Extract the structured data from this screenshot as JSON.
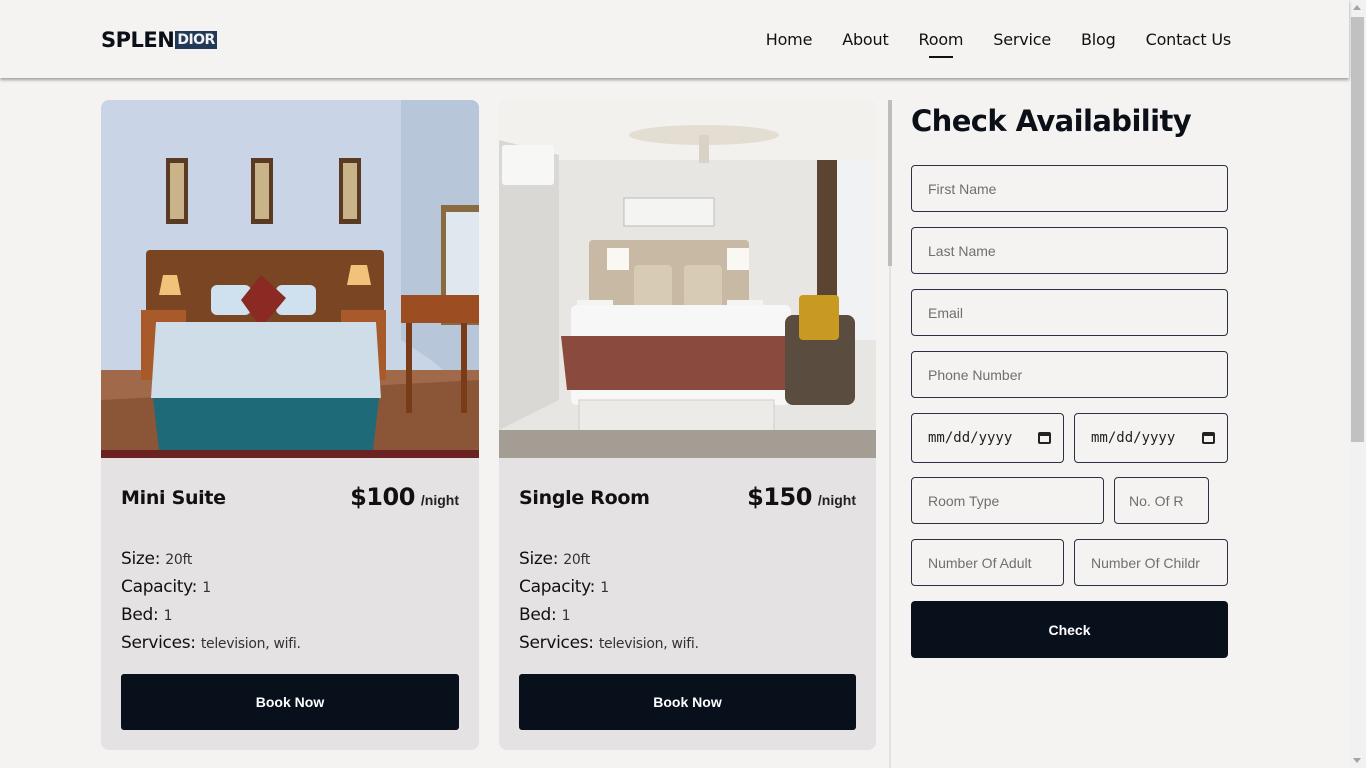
{
  "header": {
    "logo_part1": "SPLEN",
    "logo_part2": "DIOR",
    "nav": [
      "Home",
      "About",
      "Room",
      "Service",
      "Blog",
      "Contact Us"
    ],
    "active_nav": "Room"
  },
  "rooms": [
    {
      "name": "Mini Suite",
      "price": "$100",
      "per": "/night",
      "size_label": "Size:",
      "size": "20ft",
      "capacity_label": "Capacity:",
      "capacity": "1",
      "bed_label": "Bed:",
      "bed": "1",
      "services_label": "Services:",
      "services": "television, wifi.",
      "button": "Book Now"
    },
    {
      "name": "Single Room",
      "price": "$150",
      "per": "/night",
      "size_label": "Size:",
      "size": "20ft",
      "capacity_label": "Capacity:",
      "capacity": "1",
      "bed_label": "Bed:",
      "bed": "1",
      "services_label": "Services:",
      "services": "television, wifi.",
      "button": "Book Now"
    }
  ],
  "form": {
    "title": "Check Availability",
    "first_name": "First Name",
    "last_name": "Last Name",
    "email": "Email",
    "phone": "Phone Number",
    "check_in": "mm/dd/yyyy",
    "check_out": "mm/dd/yyyy",
    "room_type": "Room Type",
    "num_rooms": "No. Of R",
    "adults": "Number Of Adult",
    "children": "Number Of Childr",
    "submit": "Check"
  },
  "colors": {
    "background": "#f5f2f2",
    "card": "#e4e2e3",
    "button": "#08101c",
    "logo_badge": "#1f3957"
  }
}
